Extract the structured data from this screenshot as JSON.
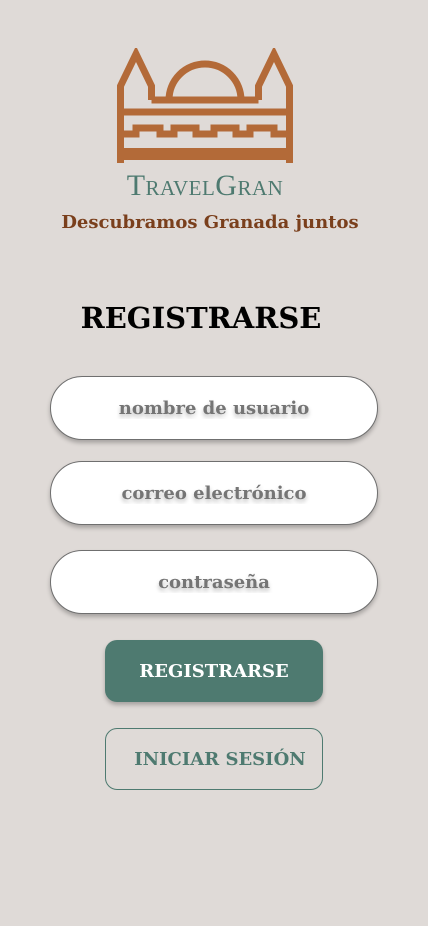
{
  "header": {
    "logo_icon": "cathedral-logo-icon",
    "app_name": "TravelGran",
    "tagline": "Descubramos Granada juntos"
  },
  "form": {
    "title": "REGISTRARSE",
    "username_placeholder": "nombre de usuario",
    "email_placeholder": "correo electrónico",
    "password_placeholder": "contraseña",
    "register_label": "REGISTRARSE",
    "login_label": "INICIAR SESIÓN"
  },
  "colors": {
    "background": "#dfdad7",
    "brand_green": "#4e7a70",
    "logo_brown": "#b36a38",
    "tagline_brown": "#7a3f1c"
  }
}
